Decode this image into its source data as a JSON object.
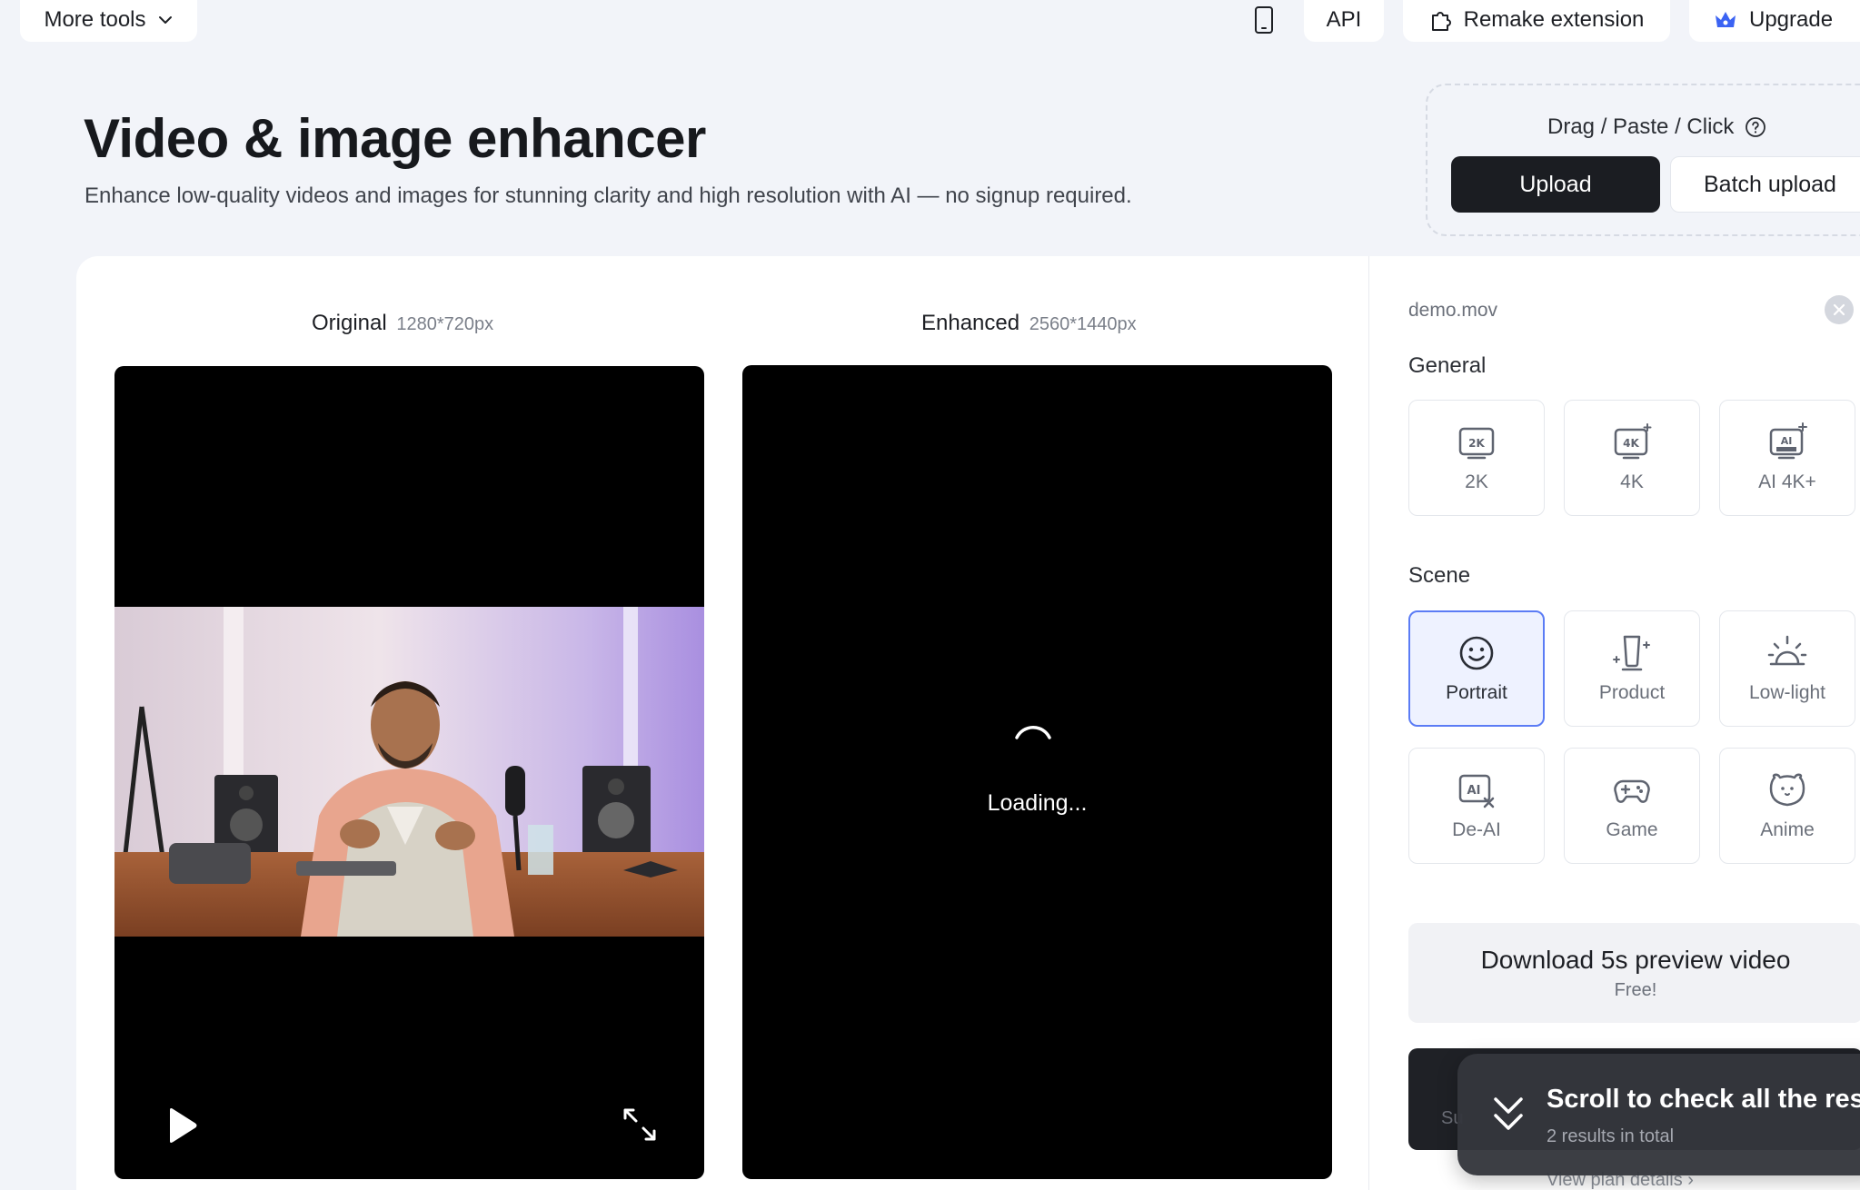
{
  "topbar": {
    "more_tools": "More tools",
    "api": "API",
    "remake_extension": "Remake extension",
    "upgrade": "Upgrade"
  },
  "hero": {
    "title": "Video & image enhancer",
    "subtitle": "Enhance low-quality videos and images for stunning clarity and high resolution with AI — no signup required."
  },
  "upload": {
    "hint": "Drag / Paste / Click",
    "upload_label": "Upload",
    "batch_label": "Batch upload"
  },
  "preview": {
    "original": {
      "label": "Original",
      "dims": "1280*720px"
    },
    "enhanced": {
      "label": "Enhanced",
      "dims": "2560*1440px"
    },
    "loading": "Loading..."
  },
  "panel": {
    "file_name": "demo.mov",
    "general_title": "General",
    "general_options": [
      {
        "label": "2K",
        "icon": "2k-icon"
      },
      {
        "label": "4K",
        "icon": "4k-icon"
      },
      {
        "label": "AI 4K+",
        "icon": "ai-ultra-icon"
      }
    ],
    "scene_title": "Scene",
    "scene_options": [
      {
        "label": "Portrait",
        "icon": "smiley-face-icon",
        "selected": true
      },
      {
        "label": "Product",
        "icon": "product-bottle-icon",
        "selected": false
      },
      {
        "label": "Low-light",
        "icon": "sunrise-icon",
        "selected": false
      },
      {
        "label": "De-AI",
        "icon": "de-ai-icon",
        "selected": false
      },
      {
        "label": "Game",
        "icon": "gamepad-icon",
        "selected": false
      },
      {
        "label": "Anime",
        "icon": "anime-bear-icon",
        "selected": false
      }
    ],
    "download_preview": {
      "title": "Download 5s preview video",
      "subtitle": "Free!"
    },
    "dark_cta_partial": "Su",
    "view_plan": "View plan details ›"
  },
  "toast": {
    "title": "Scroll to check all the resu",
    "subtitle": "2 results in total"
  },
  "colors": {
    "page_bg": "#f2f4f9",
    "primary_dark": "#1b1d22",
    "selected_accent": "#5b7cf5",
    "upgrade_icon": "#3b63f3"
  }
}
